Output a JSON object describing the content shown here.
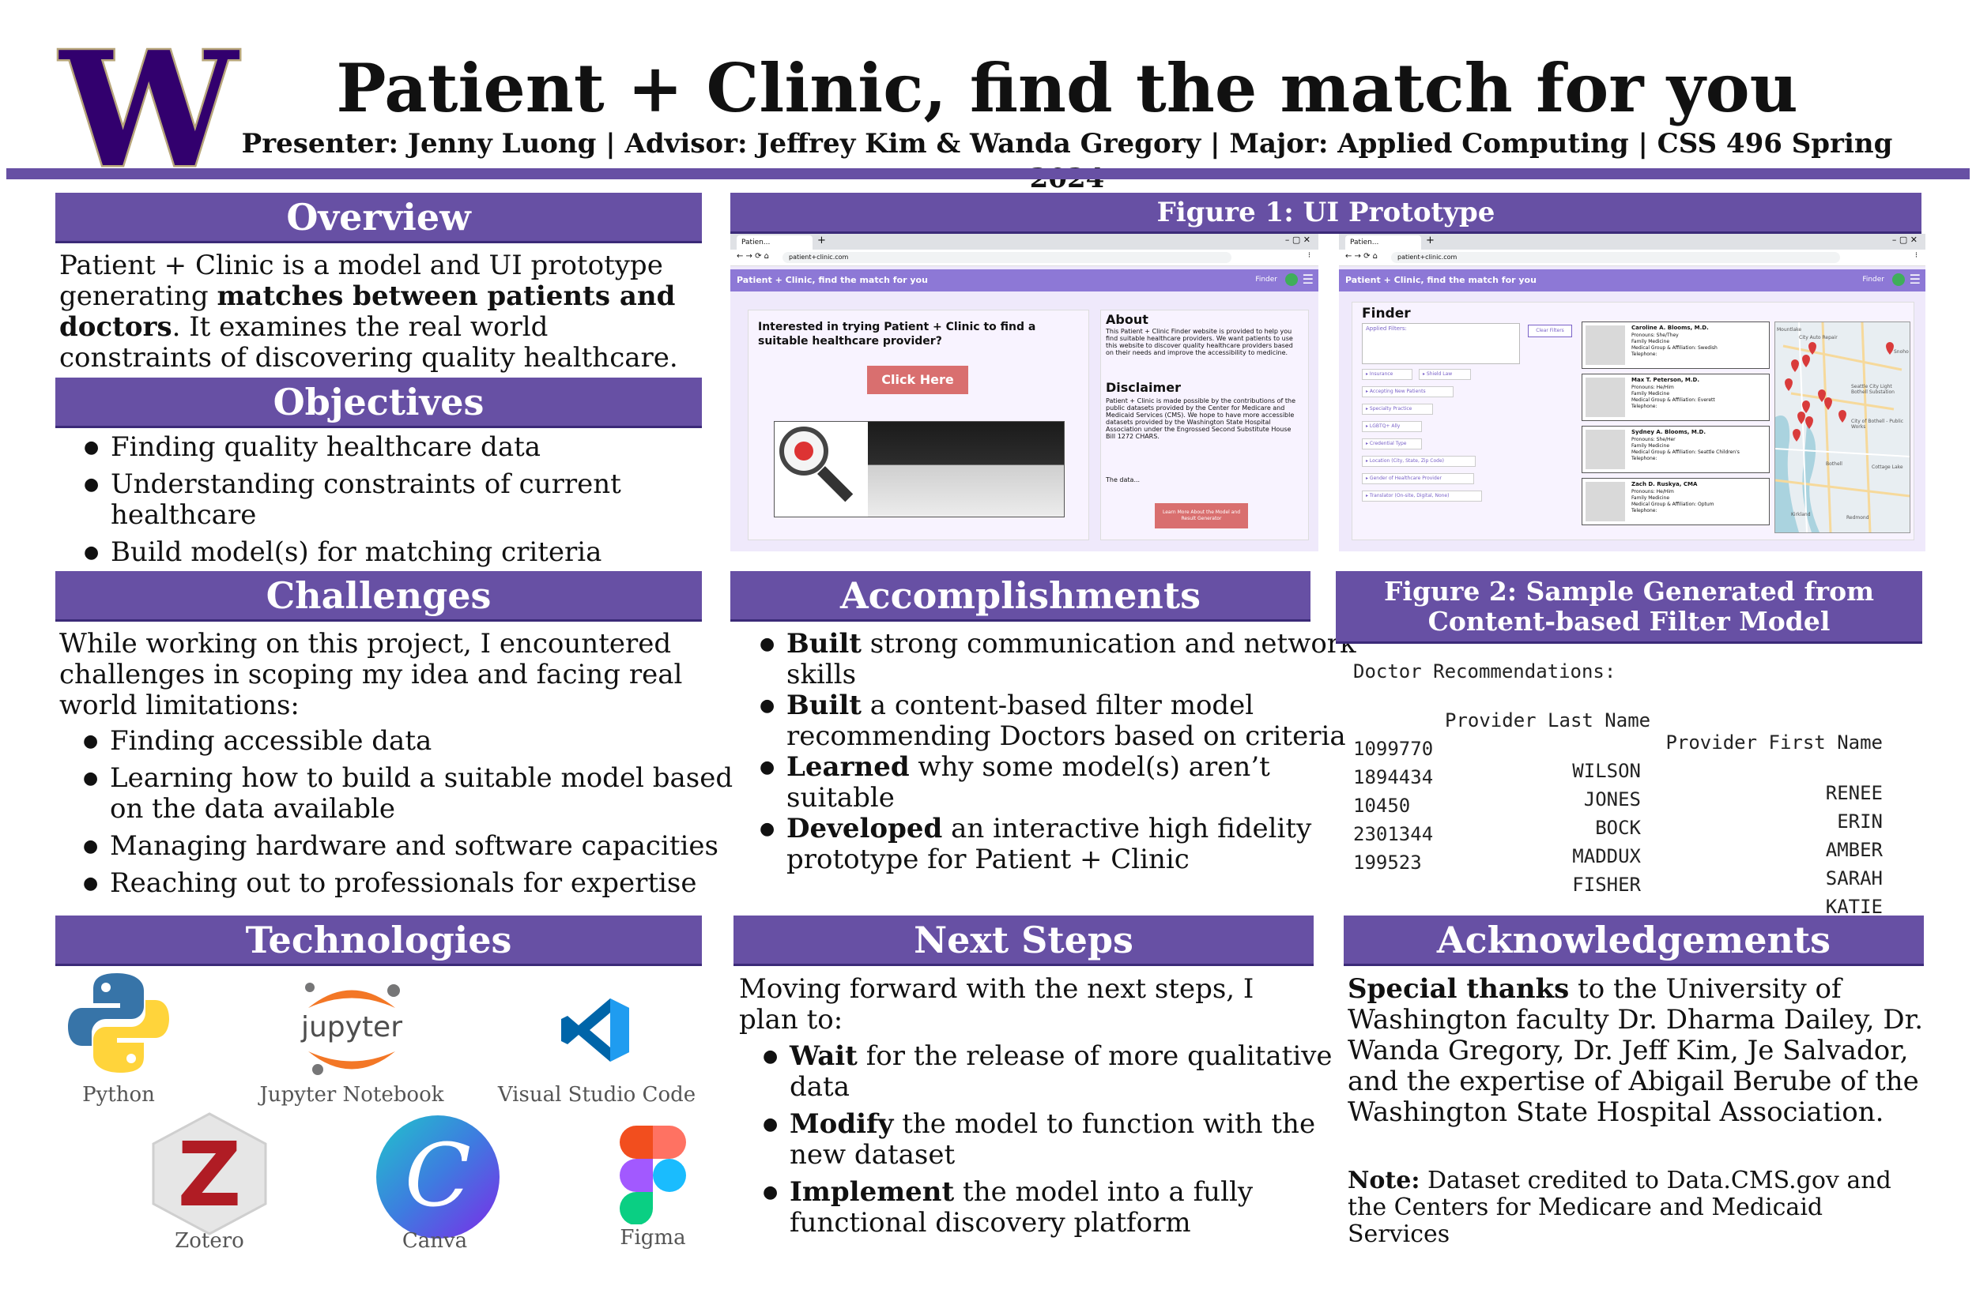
{
  "header": {
    "logo_letter": "W",
    "title": "Patient + Clinic, find the match for you",
    "subtitle": "Presenter: Jenny Luong | Advisor: Jeffrey Kim & Wanda Gregory | Major: Applied Computing | CSS 496 Spring 2024"
  },
  "colors": {
    "purple": "#6750a4",
    "uw_gold": "#b7a57a",
    "uw_purple": "#32006e"
  },
  "overview": {
    "title": "Overview",
    "p1": "Patient + Clinic is a model and UI prototype generating ",
    "p_bold": "matches between patients and doctors",
    "p2": ". It examines the real world constraints of discovering quality healthcare."
  },
  "objectives": {
    "title": "Objectives",
    "items": [
      "Finding quality healthcare data",
      "Understanding constraints of current healthcare",
      "Build model(s) for matching criteria"
    ]
  },
  "challenges": {
    "title": "Challenges",
    "intro": "While working on this project, I encountered challenges in scoping my idea and facing real world limitations:",
    "items": [
      "Finding accessible data",
      "Learning how to build a suitable model based on the data available",
      "Managing hardware and software capacities",
      "Reaching out to professionals for expertise"
    ]
  },
  "technologies": {
    "title": "Technologies",
    "items": [
      {
        "label": "Python",
        "icon": "python-icon"
      },
      {
        "label": "Jupyter Notebook",
        "icon": "jupyter-icon"
      },
      {
        "label": "Visual Studio Code",
        "icon": "vscode-icon"
      },
      {
        "label": "Zotero",
        "icon": "zotero-icon",
        "glyph": "Z"
      },
      {
        "label": "Canva",
        "icon": "canva-icon",
        "glyph": "C"
      },
      {
        "label": "Figma",
        "icon": "figma-icon"
      }
    ],
    "jupyter_word": "jupyter"
  },
  "figure1": {
    "title": "Figure 1: UI Prototype",
    "left": {
      "tab": "Patien...",
      "url": "patient+clinic.com",
      "nav_title": "Patient + Clinic, find the match for you",
      "nav_link": "Finder",
      "question": "Interested in trying Patient + Clinic to find a suitable healthcare provider?",
      "button": "Click Here",
      "about_title": "About",
      "about_text": "This Patient + Clinic Finder website is provided to help you find suitable healthcare providers. We want patients to use this website to discover quality healthcare providers based on their needs and improve the accessibility to medicine.",
      "disclaimer_title": "Disclaimer",
      "disclaimer_text": "Patient + Clinic is made possible by the contributions of the public datasets provided by the Center for Medicare and Medicaid Services (CMS). We hope to have more accessible datasets provided by the Washington State Hospital Association under the Engrossed Second Substitute House Bill 1272 CHARS.",
      "data_text": "The data...",
      "learn_button": "Learn More About the Model and Result Generator"
    },
    "right": {
      "tab": "Patien...",
      "url": "patient+clinic.com",
      "nav_title": "Patient + Clinic, find the match for you",
      "nav_link": "Finder",
      "finder_title": "Finder",
      "applied_filters": "Applied Filters:",
      "clear_filters": "Clear Filters",
      "filters": [
        "Insurance",
        "Shield Law",
        "Accepting New Patients",
        "Specialty Practice",
        "LGBTQ+ Ally",
        "Credential Type",
        "Location (City, State, Zip Code)",
        "Gender of Healthcare Provider",
        "Translator (On-site, Digital, None)"
      ],
      "doctors": [
        {
          "name": "Caroline A. Blooms, M.D.",
          "pronouns": "Pronouns: She/They",
          "spec": "Family Medicine",
          "group": "Medical Group & Affiliation: Swedish",
          "phone": "Telephone:"
        },
        {
          "name": "Max T. Peterson, M.D.",
          "pronouns": "Pronouns: He/Him",
          "spec": "Family Medicine",
          "group": "Medical Group & Affiliation: Everett",
          "phone": "Telephone:"
        },
        {
          "name": "Sydney A. Blooms, M.D.",
          "pronouns": "Pronouns: She/Her",
          "spec": "Family Medicine",
          "group": "Medical Group & Affiliation: Seattle Children's",
          "phone": "Telephone:"
        },
        {
          "name": "Zach D. Ruskya, CMA",
          "pronouns": "Pronouns: He/Him",
          "spec": "Family Medicine",
          "group": "Medical Group & Affiliation: Optum",
          "phone": "Telephone:"
        }
      ],
      "map_labels": [
        "Mountlake",
        "City Auto Repair",
        "Seattle City Light Bothell Substation",
        "City of Bothell - Public Works",
        "Kirkland",
        "Redmond",
        "Cottage Lake",
        "Snoho",
        "Bothell"
      ]
    }
  },
  "accomplishments": {
    "title": "Accomplishments",
    "items": [
      {
        "bold": "Built",
        "rest": " strong communication and network skills"
      },
      {
        "bold": "Built",
        "rest": " a content-based filter model recommending Doctors based on criteria"
      },
      {
        "bold": "Learned",
        "rest": " why some model(s) aren’t suitable"
      },
      {
        "bold": "Developed",
        "rest": " an interactive high fidelity prototype for Patient + Clinic"
      }
    ]
  },
  "figure2": {
    "title": "Figure 2: Sample Generated from Content-based Filter Model",
    "caption": "Doctor Recommendations:",
    "columns": [
      "Provider Last Name",
      "Provider First Name"
    ],
    "rows": [
      {
        "id": "1099770",
        "last": "WILSON",
        "first": "RENEE"
      },
      {
        "id": "1894434",
        "last": "JONES",
        "first": "ERIN"
      },
      {
        "id": "10450",
        "last": "BOCK",
        "first": "AMBER"
      },
      {
        "id": "2301344",
        "last": "MADDUX",
        "first": "SARAH"
      },
      {
        "id": "199523",
        "last": "FISHER",
        "first": "KATIE"
      }
    ]
  },
  "next_steps": {
    "title": "Next Steps",
    "intro": "Moving forward with the next steps, I plan to:",
    "items": [
      {
        "bold": "Wait",
        "rest": " for the release of more qualitative data"
      },
      {
        "bold": "Modify",
        "rest": " the model to function with the new dataset"
      },
      {
        "bold": "Implement",
        "rest": " the model into a fully functional discovery platform"
      }
    ]
  },
  "acknowledgements": {
    "title": "Acknowledgements",
    "bold": "Special thanks",
    "text": " to the University of Washington faculty Dr. Dharma Dailey, Dr. Wanda Gregory, Dr. Jeff Kim, Je Salvador, and the expertise of Abigail Berube of the Washington State Hospital Association.",
    "note_bold": "Note:",
    "note_text": " Dataset credited to Data.CMS.gov and the Centers for Medicare and Medicaid Services"
  }
}
